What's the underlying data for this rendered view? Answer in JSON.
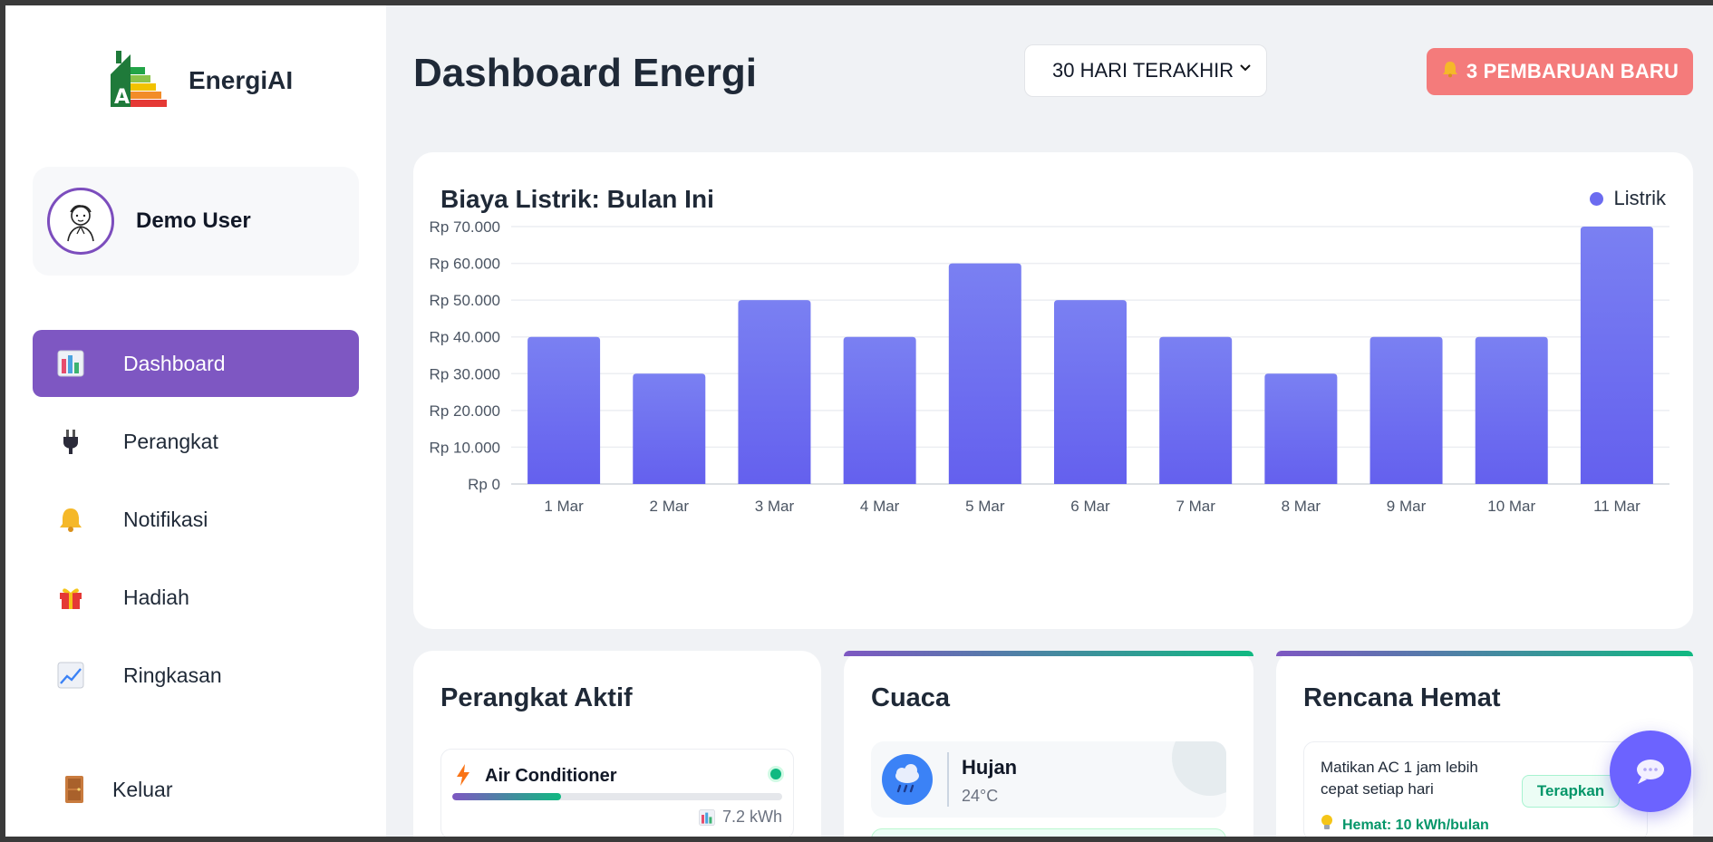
{
  "app": {
    "name": "EnergiAI"
  },
  "user": {
    "name": "Demo User"
  },
  "sidebar": {
    "items": [
      {
        "label": "Dashboard",
        "icon": "bar-chart-icon",
        "active": true
      },
      {
        "label": "Perangkat",
        "icon": "plug-icon"
      },
      {
        "label": "Notifikasi",
        "icon": "bell-icon"
      },
      {
        "label": "Hadiah",
        "icon": "gift-icon"
      },
      {
        "label": "Ringkasan",
        "icon": "trend-chart-icon"
      }
    ],
    "logout_label": "Keluar"
  },
  "header": {
    "title": "Dashboard Energi",
    "range_select": "30 HARI TERAKHIR",
    "updates_button": "3 PEMBARUAN BARU"
  },
  "colors": {
    "accent": "#7e57c2",
    "bar": "#6c6cf0",
    "alert": "#f47b7b",
    "success": "#10b981"
  },
  "chart_data": {
    "type": "bar",
    "title": "Biaya Listrik: Bulan Ini",
    "legend": [
      "Listrik"
    ],
    "legend_position": "top-right",
    "categories": [
      "1 Mar",
      "2 Mar",
      "3 Mar",
      "4 Mar",
      "5 Mar",
      "6 Mar",
      "7 Mar",
      "8 Mar",
      "9 Mar",
      "10 Mar",
      "11 Mar"
    ],
    "series": [
      {
        "name": "Listrik",
        "values": [
          40000,
          30000,
          50000,
          40000,
          60000,
          50000,
          40000,
          30000,
          40000,
          40000,
          70000
        ]
      }
    ],
    "ylim": [
      0,
      70000
    ],
    "yticks": [
      "Rp 0",
      "Rp 10.000",
      "Rp 20.000",
      "Rp 30.000",
      "Rp 40.000",
      "Rp 50.000",
      "Rp 60.000",
      "Rp 70.000"
    ],
    "grid": true
  },
  "devices": {
    "title": "Perangkat Aktif",
    "items": [
      {
        "name": "Air Conditioner",
        "energy": "7.2 kWh",
        "usage_fraction": 0.33,
        "status": "on"
      }
    ]
  },
  "weather": {
    "title": "Cuaca",
    "condition": "Hujan",
    "temperature": "24°C"
  },
  "plan": {
    "title": "Rencana Hemat",
    "items": [
      {
        "text": "Matikan AC 1 jam lebih cepat setiap hari",
        "action": "Terapkan",
        "saving": "Hemat: 10 kWh/bulan"
      }
    ]
  }
}
